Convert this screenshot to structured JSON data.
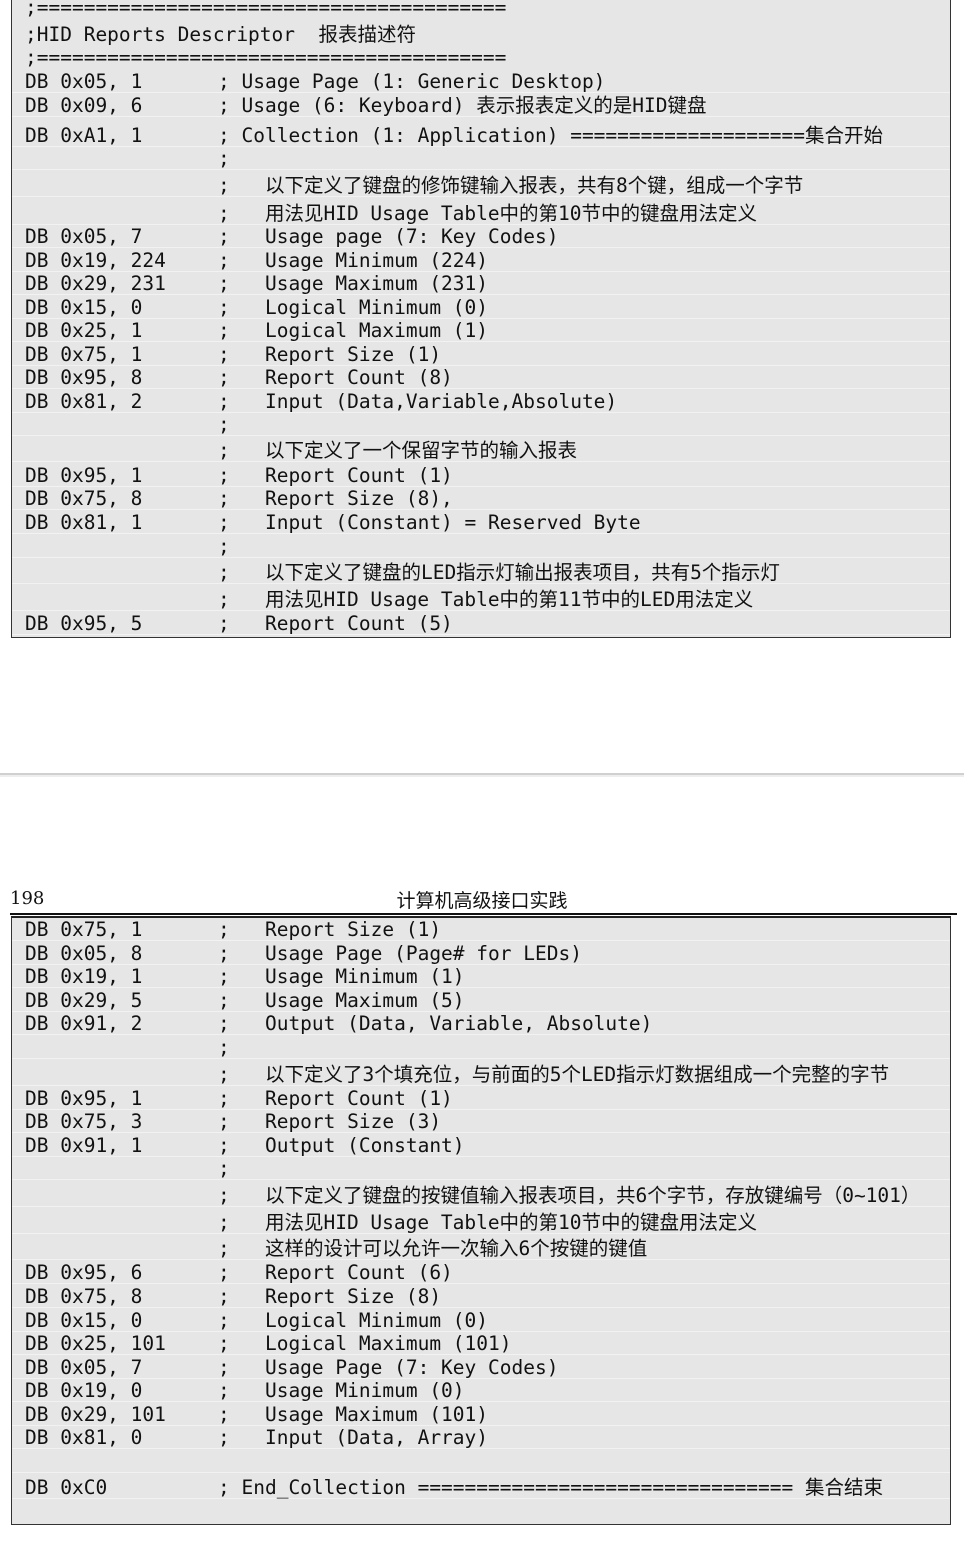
{
  "top_block": {
    "header": [
      ";========================================",
      ";HID Reports Descriptor  报表描述符",
      ";========================================"
    ],
    "lines": [
      {
        "code": "DB 0x05, 1",
        "comment": "; Usage Page (1: Generic Desktop)"
      },
      {
        "code": "DB 0x09, 6",
        "comment": "; Usage (6: Keyboard) 表示报表定义的是HID键盘"
      },
      {
        "code": "DB 0xA1, 1",
        "comment": "; Collection (1: Application) ====================集合开始"
      },
      {
        "code": "",
        "comment": ";"
      },
      {
        "code": "",
        "comment": ";   以下定义了键盘的修饰键输入报表，共有8个键，组成一个字节"
      },
      {
        "code": "",
        "comment": ";   用法见HID Usage Table中的第10节中的键盘用法定义"
      },
      {
        "code": "DB 0x05, 7",
        "comment": ";   Usage page (7: Key Codes)"
      },
      {
        "code": "DB 0x19, 224",
        "comment": ";   Usage Minimum (224)"
      },
      {
        "code": "DB 0x29, 231",
        "comment": ";   Usage Maximum (231)"
      },
      {
        "code": "DB 0x15, 0",
        "comment": ";   Logical Minimum (0)"
      },
      {
        "code": "DB 0x25, 1",
        "comment": ";   Logical Maximum (1)"
      },
      {
        "code": "DB 0x75, 1",
        "comment": ";   Report Size (1)"
      },
      {
        "code": "DB 0x95, 8",
        "comment": ";   Report Count (8)"
      },
      {
        "code": "DB 0x81, 2",
        "comment": ";   Input (Data,Variable,Absolute)"
      },
      {
        "code": "",
        "comment": ";"
      },
      {
        "code": "",
        "comment": ";   以下定义了一个保留字节的输入报表"
      },
      {
        "code": "DB 0x95, 1",
        "comment": ";   Report Count (1)"
      },
      {
        "code": "DB 0x75, 8",
        "comment": ";   Report Size (8),"
      },
      {
        "code": "DB 0x81, 1",
        "comment": ";   Input (Constant) = Reserved Byte"
      },
      {
        "code": "",
        "comment": ";"
      },
      {
        "code": "",
        "comment": ";   以下定义了键盘的LED指示灯输出报表项目，共有5个指示灯"
      },
      {
        "code": "",
        "comment": ";   用法见HID Usage Table中的第11节中的LED用法定义"
      },
      {
        "code": "DB 0x95, 5",
        "comment": ";   Report Count (5)"
      }
    ]
  },
  "page_header": {
    "page_number": "198",
    "title": "计算机高级接口实践"
  },
  "bottom_block": {
    "lines": [
      {
        "code": "DB 0x75, 1",
        "comment": ";   Report Size (1)"
      },
      {
        "code": "DB 0x05, 8",
        "comment": ";   Usage Page (Page# for LEDs)"
      },
      {
        "code": "DB 0x19, 1",
        "comment": ";   Usage Minimum (1)"
      },
      {
        "code": "DB 0x29, 5",
        "comment": ";   Usage Maximum (5)"
      },
      {
        "code": "DB 0x91, 2",
        "comment": ";   Output (Data, Variable, Absolute)"
      },
      {
        "code": "",
        "comment": ";"
      },
      {
        "code": "",
        "comment": ";   以下定义了3个填充位，与前面的5个LED指示灯数据组成一个完整的字节"
      },
      {
        "code": "DB 0x95, 1",
        "comment": ";   Report Count (1)"
      },
      {
        "code": "DB 0x75, 3",
        "comment": ";   Report Size (3)"
      },
      {
        "code": "DB 0x91, 1",
        "comment": ";   Output (Constant)"
      },
      {
        "code": "",
        "comment": ";"
      },
      {
        "code": "",
        "comment": ";   以下定义了键盘的按键值输入报表项目，共6个字节，存放键编号（0~101）"
      },
      {
        "code": "",
        "comment": ";   用法见HID Usage Table中的第10节中的键盘用法定义"
      },
      {
        "code": "",
        "comment": ";   这样的设计可以允许一次输入6个按键的键值"
      },
      {
        "code": "DB 0x95, 6",
        "comment": ";   Report Count (6)"
      },
      {
        "code": "DB 0x75, 8",
        "comment": ";   Report Size (8)"
      },
      {
        "code": "DB 0x15, 0",
        "comment": ";   Logical Minimum (0)"
      },
      {
        "code": "DB 0x25, 101",
        "comment": ";   Logical Maximum (101)"
      },
      {
        "code": "DB 0x05, 7",
        "comment": ";   Usage Page (7: Key Codes)"
      },
      {
        "code": "DB 0x19, 0",
        "comment": ";   Usage Minimum (0)"
      },
      {
        "code": "DB 0x29, 101",
        "comment": ";   Usage Maximum (101)"
      },
      {
        "code": "DB 0x81, 0",
        "comment": ";   Input (Data, Array)"
      },
      {
        "code": "",
        "comment": ""
      },
      {
        "code": "DB 0xC0",
        "comment": "; End_Collection ================================ 集合结束"
      }
    ]
  }
}
